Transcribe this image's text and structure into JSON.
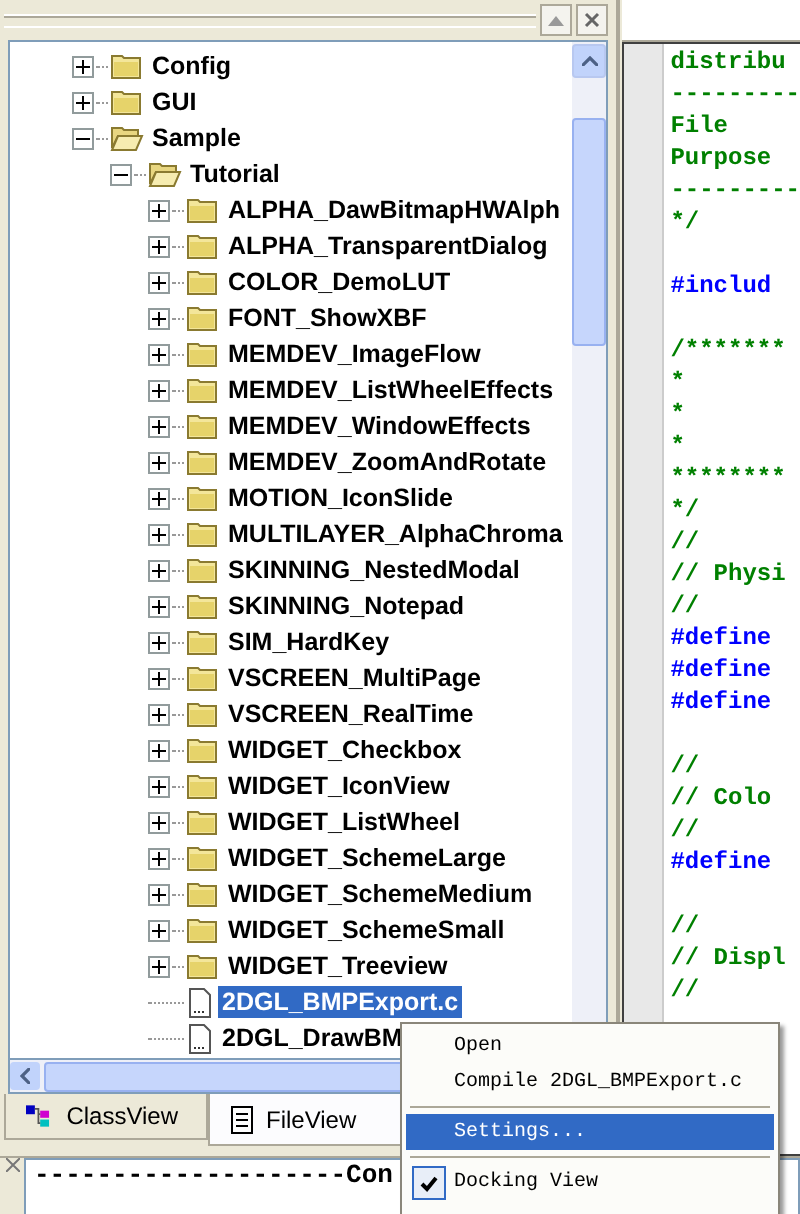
{
  "tree": [
    {
      "label": "Config",
      "kind": "folder",
      "expanded": false,
      "selected": false
    },
    {
      "label": "GUI",
      "kind": "folder",
      "expanded": false,
      "selected": false
    },
    {
      "label": "Sample",
      "kind": "folder",
      "expanded": true,
      "selected": false,
      "children": [
        {
          "label": "Tutorial",
          "kind": "folder",
          "expanded": true,
          "selected": false,
          "children": [
            {
              "label": "ALPHA_DawBitmapHWAlph",
              "kind": "folder",
              "expanded": false,
              "selected": false
            },
            {
              "label": "ALPHA_TransparentDialog",
              "kind": "folder",
              "expanded": false,
              "selected": false
            },
            {
              "label": "COLOR_DemoLUT",
              "kind": "folder",
              "expanded": false,
              "selected": false
            },
            {
              "label": "FONT_ShowXBF",
              "kind": "folder",
              "expanded": false,
              "selected": false
            },
            {
              "label": "MEMDEV_ImageFlow",
              "kind": "folder",
              "expanded": false,
              "selected": false
            },
            {
              "label": "MEMDEV_ListWheelEffects",
              "kind": "folder",
              "expanded": false,
              "selected": false
            },
            {
              "label": "MEMDEV_WindowEffects",
              "kind": "folder",
              "expanded": false,
              "selected": false
            },
            {
              "label": "MEMDEV_ZoomAndRotate",
              "kind": "folder",
              "expanded": false,
              "selected": false
            },
            {
              "label": "MOTION_IconSlide",
              "kind": "folder",
              "expanded": false,
              "selected": false
            },
            {
              "label": "MULTILAYER_AlphaChroma",
              "kind": "folder",
              "expanded": false,
              "selected": false
            },
            {
              "label": "SKINNING_NestedModal",
              "kind": "folder",
              "expanded": false,
              "selected": false
            },
            {
              "label": "SKINNING_Notepad",
              "kind": "folder",
              "expanded": false,
              "selected": false
            },
            {
              "label": "SIM_HardKey",
              "kind": "folder",
              "expanded": false,
              "selected": false
            },
            {
              "label": "VSCREEN_MultiPage",
              "kind": "folder",
              "expanded": false,
              "selected": false
            },
            {
              "label": "VSCREEN_RealTime",
              "kind": "folder",
              "expanded": false,
              "selected": false
            },
            {
              "label": "WIDGET_Checkbox",
              "kind": "folder",
              "expanded": false,
              "selected": false
            },
            {
              "label": "WIDGET_IconView",
              "kind": "folder",
              "expanded": false,
              "selected": false
            },
            {
              "label": "WIDGET_ListWheel",
              "kind": "folder",
              "expanded": false,
              "selected": false
            },
            {
              "label": "WIDGET_SchemeLarge",
              "kind": "folder",
              "expanded": false,
              "selected": false
            },
            {
              "label": "WIDGET_SchemeMedium",
              "kind": "folder",
              "expanded": false,
              "selected": false
            },
            {
              "label": "WIDGET_SchemeSmall",
              "kind": "folder",
              "expanded": false,
              "selected": false
            },
            {
              "label": "WIDGET_Treeview",
              "kind": "folder",
              "expanded": false,
              "selected": false
            },
            {
              "label": "2DGL_BMPExport.c",
              "kind": "file",
              "selected": true
            },
            {
              "label": "2DGL_DrawBM",
              "kind": "file",
              "selected": false
            }
          ]
        }
      ]
    }
  ],
  "tabs": [
    {
      "label": "ClassView",
      "kind": "classview",
      "selected": false
    },
    {
      "label": "FileView",
      "kind": "fileview",
      "selected": true
    }
  ],
  "editor": {
    "lines": [
      {
        "text": "distribu",
        "kind": "comment"
      },
      {
        "text": "---------",
        "kind": "comment"
      },
      {
        "text": "File",
        "kind": "comment"
      },
      {
        "text": "Purpose",
        "kind": "comment"
      },
      {
        "text": "---------",
        "kind": "comment"
      },
      {
        "text": "*/",
        "kind": "comment"
      },
      {
        "kind": "blank"
      },
      {
        "text": "#includ",
        "kind": "directive"
      },
      {
        "kind": "blank"
      },
      {
        "text": "/*******",
        "kind": "comment"
      },
      {
        "text": "*",
        "kind": "comment"
      },
      {
        "text": "*",
        "kind": "comment"
      },
      {
        "text": "*",
        "kind": "comment"
      },
      {
        "text": "********",
        "kind": "comment"
      },
      {
        "text": "*/",
        "kind": "comment"
      },
      {
        "text": "//",
        "kind": "comment"
      },
      {
        "text": "// Physi",
        "kind": "comment"
      },
      {
        "text": "//",
        "kind": "comment"
      },
      {
        "text": "#define",
        "kind": "directive"
      },
      {
        "text": "#define",
        "kind": "directive"
      },
      {
        "text": "#define",
        "kind": "directive"
      },
      {
        "kind": "blank"
      },
      {
        "text": "//",
        "kind": "comment"
      },
      {
        "text": "// Colo",
        "kind": "comment"
      },
      {
        "text": "//",
        "kind": "comment"
      },
      {
        "text": "#define",
        "kind": "directive"
      },
      {
        "kind": "blank"
      },
      {
        "text": "//",
        "kind": "comment"
      },
      {
        "text": "// Displ",
        "kind": "comment"
      },
      {
        "text": "//",
        "kind": "comment"
      }
    ]
  },
  "output": {
    "text": "--------------------Con"
  },
  "context_menu": {
    "items": [
      {
        "kind": "item",
        "label": "Open",
        "selected": false,
        "checked": false
      },
      {
        "kind": "item",
        "label": "Compile 2DGL_BMPExport.c",
        "selected": false,
        "checked": false
      },
      {
        "kind": "separator"
      },
      {
        "kind": "item",
        "label": "Settings...",
        "selected": true,
        "checked": false
      },
      {
        "kind": "separator"
      },
      {
        "kind": "item",
        "label": "Docking View",
        "selected": false,
        "checked": true
      }
    ]
  }
}
